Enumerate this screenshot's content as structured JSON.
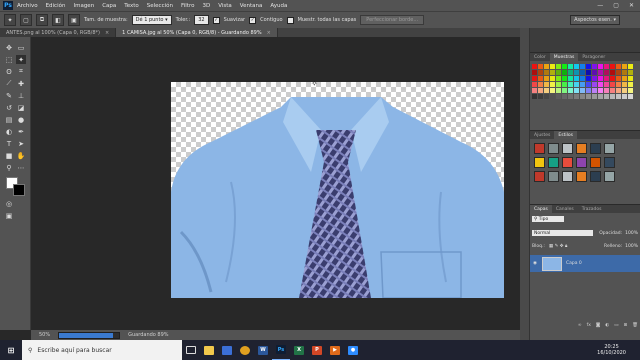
{
  "app": {
    "logo": "Ps"
  },
  "menu": [
    "Archivo",
    "Edición",
    "Imagen",
    "Capa",
    "Texto",
    "Selección",
    "Filtro",
    "3D",
    "Vista",
    "Ventana",
    "Ayuda"
  ],
  "window_controls": {
    "minimize": "—",
    "maximize": "▢",
    "close": "✕"
  },
  "options_bar": {
    "sample_size_label": "Tam. de muestra:",
    "sample_size_value": "Dé 1 punto",
    "tolerance_label": "Toler.:",
    "tolerance_value": "32",
    "antialias_label": "Suavizar",
    "contiguous_label": "Contiguo",
    "sample_all_label": "Muestr. todas las capas",
    "refine_edge_label": "Perfeccionar borde...",
    "workspace_value": "Aspectos esen."
  },
  "tabs": [
    {
      "label": "ANTES.png al 100% (Capa 0, RGB/8*)",
      "close": "×"
    },
    {
      "label": "1 CAMISA.jpg al 50% (Capa 0, RGB/8) - Guardando 89%",
      "close": "×"
    }
  ],
  "status": {
    "zoom": "50%",
    "saving_label": "Guardando 89%",
    "progress": 0.89
  },
  "panels": {
    "color_tabs": [
      "Color",
      "Muestras",
      "Paragoner"
    ],
    "styles_tabs": [
      "Ajustes",
      "Estilos"
    ],
    "layers_tabs": [
      "Capas",
      "Canales",
      "Trazados"
    ],
    "layers": {
      "filter_value": "Tipo",
      "blend_mode": "Normal",
      "opacity_label": "Opacidad:",
      "opacity_value": "100%",
      "lock_label": "Bloq.:",
      "fill_label": "Relleno:",
      "fill_value": "100%",
      "layer_name": "Capa 0"
    }
  },
  "taskbar": {
    "search_placeholder": "Escribe aquí para buscar",
    "time": "20:25",
    "date": "16/10/2020"
  },
  "colors": {
    "ps_blue": "#31a8ff",
    "shirt_blue": "#8cb6e6",
    "tie_navy": "#3a3d6e",
    "tie_lilac": "#9a9fd2"
  },
  "icons": [
    "move-icon",
    "marquee-icon",
    "lasso-icon",
    "magic-wand-icon",
    "crop-icon",
    "eyedropper-icon",
    "healing-icon",
    "brush-icon",
    "stamp-icon",
    "history-brush-icon",
    "eraser-icon",
    "gradient-icon",
    "blur-icon",
    "dodge-icon",
    "pen-icon",
    "type-icon",
    "path-select-icon",
    "shape-icon",
    "hand-icon",
    "zoom-icon"
  ]
}
